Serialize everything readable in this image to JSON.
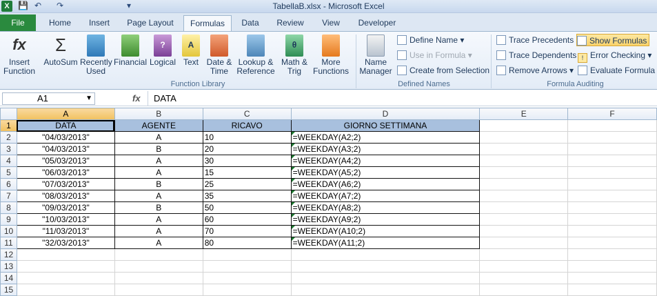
{
  "window": {
    "title": "TabellaB.xlsx - Microsoft Excel"
  },
  "qat": {
    "logo": "X",
    "save": "💾",
    "undo": "↶",
    "redo": "↷",
    "more": "▾"
  },
  "tabs": [
    "File",
    "Home",
    "Insert",
    "Page Layout",
    "Formulas",
    "Data",
    "Review",
    "View",
    "Developer"
  ],
  "ribbon": {
    "insert_function": "Insert Function",
    "library": [
      "AutoSum",
      "Recently Used",
      "Financial",
      "Logical",
      "Text",
      "Date & Time",
      "Lookup & Reference",
      "Math & Trig",
      "More Functions"
    ],
    "function_library_label": "Function Library",
    "name_manager": "Name Manager",
    "define_name": "Define Name",
    "use_in_formula": "Use in Formula",
    "create_from_selection": "Create from Selection",
    "defined_names_label": "Defined Names",
    "trace_precedents": "Trace Precedents",
    "trace_dependents": "Trace Dependents",
    "remove_arrows": "Remove Arrows",
    "show_formulas": "Show Formulas",
    "error_checking": "Error Checking",
    "evaluate_formula": "Evaluate Formula",
    "formula_auditing_label": "Formula Auditing"
  },
  "formula_bar": {
    "name_box": "A1",
    "fx": "fx",
    "content": "DATA"
  },
  "columns": [
    "A",
    "B",
    "C",
    "D",
    "E",
    "F"
  ],
  "rows": [
    "1",
    "2",
    "3",
    "4",
    "5",
    "6",
    "7",
    "8",
    "9",
    "10",
    "11",
    "12",
    "13",
    "14",
    "15"
  ],
  "headers": [
    "DATA",
    "AGENTE",
    "RICAVO",
    "GIORNO SETTIMANA"
  ],
  "data": [
    [
      "\"04/03/2013\"",
      "A",
      "10",
      "=WEEKDAY(A2;2)"
    ],
    [
      "\"04/03/2013\"",
      "B",
      "20",
      "=WEEKDAY(A3;2)"
    ],
    [
      "\"05/03/2013\"",
      "A",
      "30",
      "=WEEKDAY(A4;2)"
    ],
    [
      "\"06/03/2013\"",
      "A",
      "15",
      "=WEEKDAY(A5;2)"
    ],
    [
      "\"07/03/2013\"",
      "B",
      "25",
      "=WEEKDAY(A6;2)"
    ],
    [
      "\"08/03/2013\"",
      "A",
      "35",
      "=WEEKDAY(A7;2)"
    ],
    [
      "\"09/03/2013\"",
      "B",
      "50",
      "=WEEKDAY(A8;2)"
    ],
    [
      "\"10/03/2013\"",
      "A",
      "60",
      "=WEEKDAY(A9;2)"
    ],
    [
      "\"11/03/2013\"",
      "A",
      "70",
      "=WEEKDAY(A10;2)"
    ],
    [
      "\"32/03/2013\"",
      "A",
      "80",
      "=WEEKDAY(A11;2)"
    ]
  ]
}
